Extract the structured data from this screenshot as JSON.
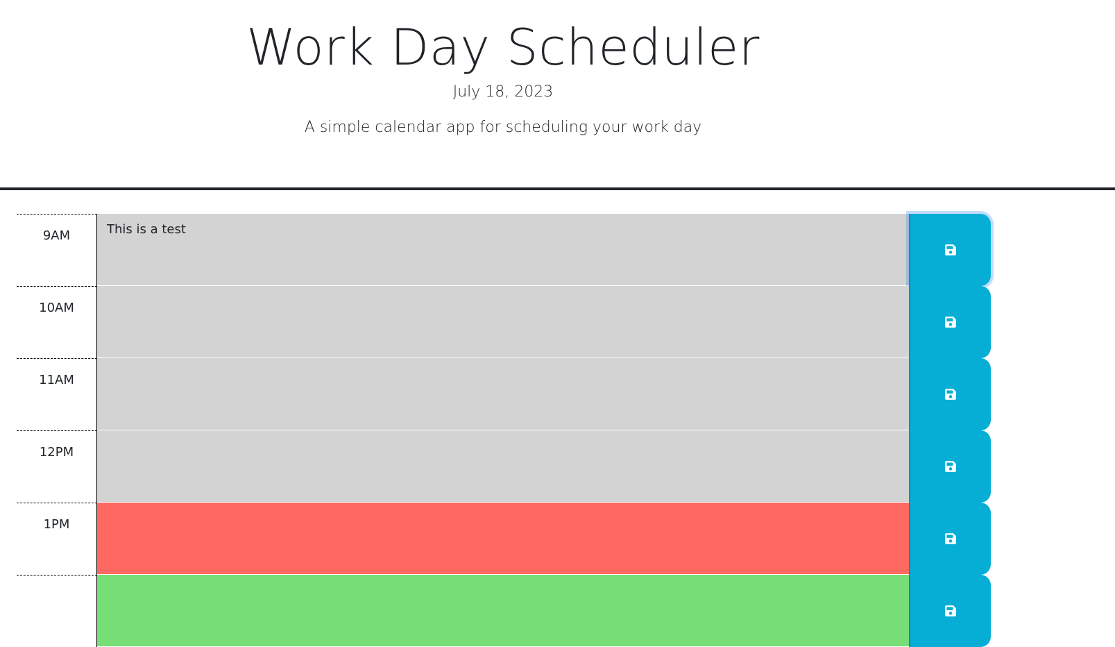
{
  "header": {
    "title": "Work Day Scheduler",
    "date": "July 18, 2023",
    "lead": "A simple calendar app for scheduling your work day"
  },
  "colors": {
    "past": "#d3d3d3",
    "present": "#ff6961",
    "future": "#77dd77",
    "save_button": "#06aed5"
  },
  "time_blocks": [
    {
      "hour": "9AM",
      "text": "This is a test",
      "state": "past",
      "save_icon": "floppy-disk-icon"
    },
    {
      "hour": "10AM",
      "text": "",
      "state": "past",
      "save_icon": "floppy-disk-icon"
    },
    {
      "hour": "11AM",
      "text": "",
      "state": "past",
      "save_icon": "floppy-disk-icon"
    },
    {
      "hour": "12PM",
      "text": "",
      "state": "past",
      "save_icon": "floppy-disk-icon"
    },
    {
      "hour": "1PM",
      "text": "",
      "state": "present",
      "save_icon": "floppy-disk-icon"
    },
    {
      "hour": "",
      "text": "",
      "state": "future",
      "save_icon": "floppy-disk-icon"
    }
  ]
}
